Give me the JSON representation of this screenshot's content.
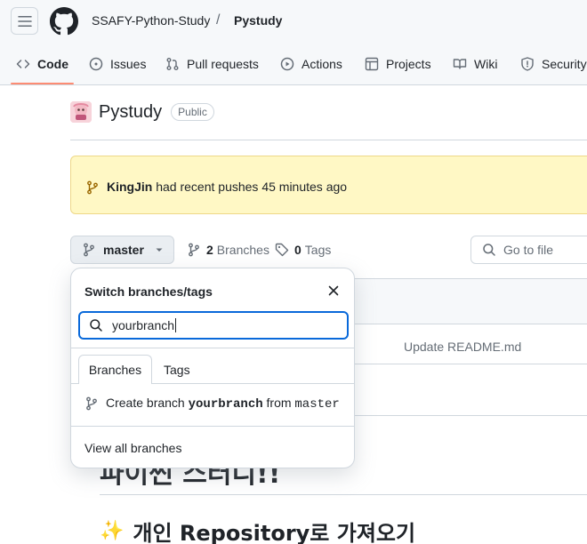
{
  "header": {
    "owner": "SSAFY-Python-Study",
    "separator": "/",
    "repo": "Pystudy"
  },
  "tabs": [
    {
      "label": "Code",
      "icon": "code-icon",
      "active": true
    },
    {
      "label": "Issues",
      "icon": "issue-icon"
    },
    {
      "label": "Pull requests",
      "icon": "pull-request-icon"
    },
    {
      "label": "Actions",
      "icon": "play-icon"
    },
    {
      "label": "Projects",
      "icon": "table-icon"
    },
    {
      "label": "Wiki",
      "icon": "book-icon"
    },
    {
      "label": "Security",
      "icon": "shield-icon"
    }
  ],
  "repo": {
    "name": "Pystudy",
    "visibility": "Public"
  },
  "banner": {
    "user": "KingJin",
    "message": "had recent pushes 45 minutes ago"
  },
  "toolbar": {
    "branch": "master",
    "branches_count": "2",
    "branches_label": "Branches",
    "tags_count": "0",
    "tags_label": "Tags",
    "goto_placeholder": "Go to file"
  },
  "file_list": {
    "commit_message": "Update README.md"
  },
  "readme": {
    "h1": "파이썬 스터디!!",
    "h2": "개인 Repository로 가져오기",
    "h2_emoji": "✨"
  },
  "dropdown": {
    "title": "Switch branches/tags",
    "search_value": "yourbranch",
    "tab_branches": "Branches",
    "tab_tags": "Tags",
    "create_prefix": "Create branch",
    "create_branch": "yourbranch",
    "create_from": "from",
    "create_source": "master",
    "view_all": "View all branches"
  },
  "colors": {
    "accent": "#0969da",
    "tab_underline": "#fd8c73",
    "banner_bg": "#fff8c5"
  }
}
